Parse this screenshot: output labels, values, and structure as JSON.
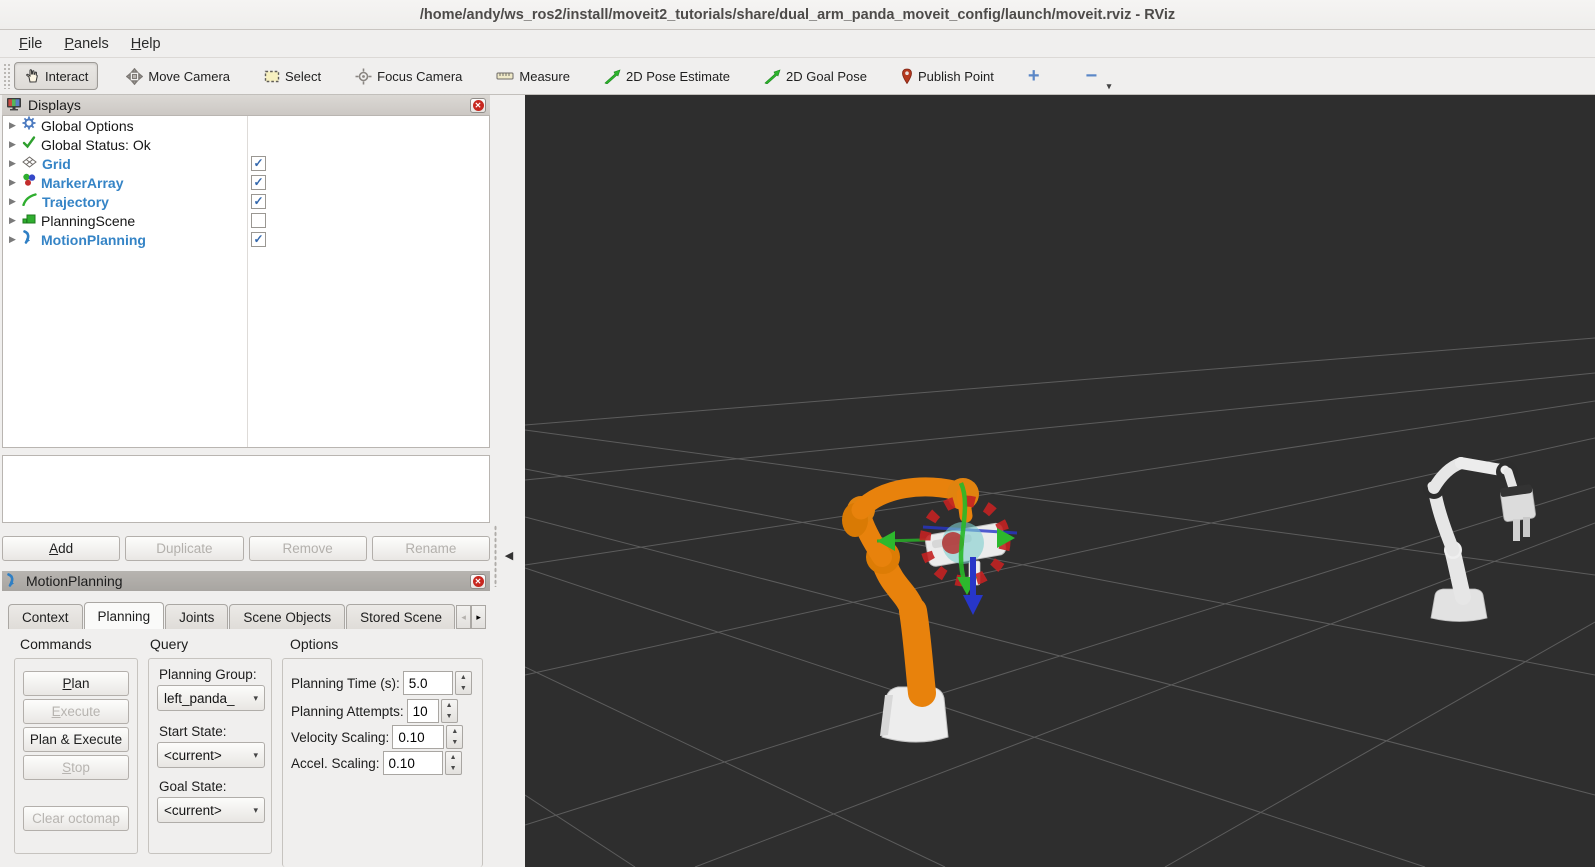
{
  "window": {
    "title": "/home/andy/ws_ros2/install/moveit2_tutorials/share/dual_arm_panda_moveit_config/launch/moveit.rviz - RViz"
  },
  "menu": {
    "file": "File",
    "panels": "Panels",
    "help": "Help"
  },
  "toolbar": {
    "interact": "Interact",
    "move_camera": "Move Camera",
    "select": "Select",
    "focus_camera": "Focus Camera",
    "measure": "Measure",
    "pose_estimate": "2D Pose Estimate",
    "goal_pose": "2D Goal Pose",
    "publish_point": "Publish Point",
    "add_tool": "+",
    "remove_tool": "−"
  },
  "displays": {
    "title": "Displays",
    "rows": [
      {
        "label": "Global Options",
        "icon": "gear-icon",
        "check": ""
      },
      {
        "label": "Global Status: Ok",
        "icon": "status-check-icon",
        "check": ""
      },
      {
        "label": "Grid",
        "icon": "grid-icon",
        "check": "✓"
      },
      {
        "label": "MarkerArray",
        "icon": "marker-array-icon",
        "check": "✓"
      },
      {
        "label": "Trajectory",
        "icon": "trajectory-icon",
        "check": "✓"
      },
      {
        "label": "PlanningScene",
        "icon": "planning-scene-icon",
        "check": ""
      },
      {
        "label": "MotionPlanning",
        "icon": "motion-planning-icon",
        "check": "✓"
      }
    ],
    "buttons": {
      "add": "Add",
      "duplicate": "Duplicate",
      "remove": "Remove",
      "rename": "Rename"
    }
  },
  "motion_planning": {
    "title": "MotionPlanning",
    "tabs": [
      "Context",
      "Planning",
      "Joints",
      "Scene Objects",
      "Stored Scene"
    ],
    "active_tab": "Planning",
    "tab_scroll_left": "◂",
    "tab_scroll_right": "▸",
    "commands": {
      "title": "Commands",
      "plan": "Plan",
      "execute": "Execute",
      "plan_execute": "Plan & Execute",
      "stop": "Stop",
      "clear_octomap": "Clear octomap"
    },
    "query": {
      "title": "Query",
      "planning_group_label": "Planning Group:",
      "planning_group": "left_panda_",
      "start_state_label": "Start State:",
      "start_state": "<current>",
      "goal_state_label": "Goal State:",
      "goal_state": "<current>"
    },
    "options": {
      "title": "Options",
      "rows": [
        {
          "label": "Planning Time (s):",
          "value": "5.0"
        },
        {
          "label": "Planning Attempts:",
          "value": "10"
        },
        {
          "label": "Velocity Scaling:",
          "value": "0.10"
        },
        {
          "label": "Accel. Scaling:",
          "value": "0.10"
        }
      ]
    }
  },
  "viewport": {
    "background": "#2e2e2e",
    "grid_color": "#8a8a8a",
    "robots": [
      {
        "name": "left-panda-goal-state",
        "color": "#e8820c"
      },
      {
        "name": "right-panda",
        "color": "#e4e4e4"
      }
    ],
    "interactive_marker": {
      "ring_color": "#c32222",
      "x_axis_color": "#28a828",
      "z_axis_color": "#2736c8",
      "sphere_color": "#7ecfcf"
    }
  }
}
